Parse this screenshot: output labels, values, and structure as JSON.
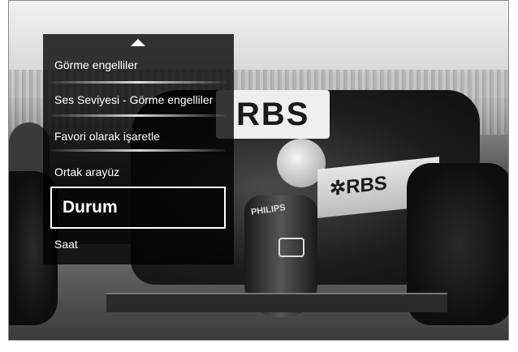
{
  "menu": {
    "items": [
      {
        "label": "Görme engelliler"
      },
      {
        "label": "Ses Seviyesi - Görme engelliler"
      },
      {
        "label": "Favori olarak işaretle"
      },
      {
        "label": "Ortak arayüz"
      },
      {
        "label": "Durum",
        "selected": true
      },
      {
        "label": "Saat"
      }
    ],
    "scroll_up_icon": "triangle-up-icon"
  },
  "background": {
    "wing_text": "RBS",
    "sidepod_text": "✲RBS",
    "nose_text": "PHILIPS"
  }
}
